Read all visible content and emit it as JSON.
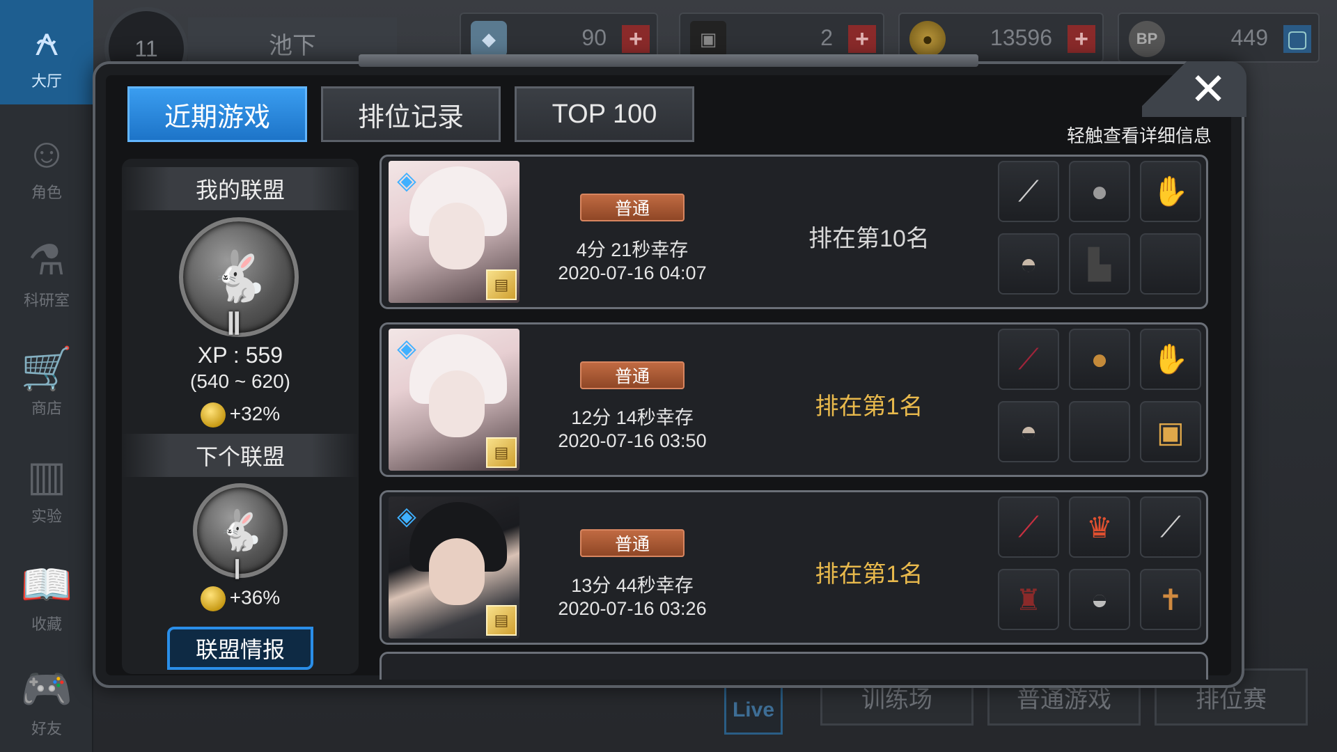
{
  "sidebar": {
    "items": [
      {
        "label": "大厅",
        "icon": "lobby-icon",
        "active": true
      },
      {
        "label": "角色",
        "icon": "character-icon"
      },
      {
        "label": "科研室",
        "icon": "flask-icon"
      },
      {
        "label": "商店",
        "icon": "cart-icon"
      },
      {
        "label": "实验",
        "icon": "books-icon"
      },
      {
        "label": "收藏",
        "icon": "book-icon"
      },
      {
        "label": "好友",
        "icon": "gamepad-icon"
      }
    ]
  },
  "topbar": {
    "level": "11",
    "player_name": "池下",
    "resources": [
      {
        "icon": "crystal-icon",
        "value": "90"
      },
      {
        "icon": "card-icon",
        "value": "2"
      },
      {
        "icon": "coin-icon",
        "value": "13596"
      },
      {
        "icon": "bp-icon",
        "value": "449",
        "symbol": "BP"
      }
    ]
  },
  "bottom_modes": [
    "训练场",
    "普通游戏",
    "排位赛"
  ],
  "live_label": "Live",
  "modal": {
    "tabs": [
      {
        "label": "近期游戏",
        "active": true
      },
      {
        "label": "排位记录",
        "active": false
      },
      {
        "label": "TOP 100",
        "active": false
      }
    ],
    "hint": "轻触查看详细信息",
    "close_symbol": "✕"
  },
  "league": {
    "my_title": "我的联盟",
    "my_tier": "Ⅱ",
    "xp": "XP : 559",
    "xp_range": "(540 ~ 620)",
    "my_bonus": "+32%",
    "next_title": "下个联盟",
    "next_tier": "Ⅰ",
    "next_bonus": "+36%",
    "info_button": "联盟情报"
  },
  "matches": [
    {
      "portrait": "white",
      "mode": "普通",
      "survive": "4分 21秒幸存",
      "datetime": "2020-07-16 04:07",
      "rank": "排在第10名",
      "top": false,
      "items": [
        "sword-icon",
        "helmet-icon",
        "glove-icon",
        "hat-icon",
        "boots-icon",
        ""
      ]
    },
    {
      "portrait": "white",
      "mode": "普通",
      "survive": "12分 14秒幸存",
      "datetime": "2020-07-16 03:50",
      "rank": "排在第1名",
      "top": true,
      "items": [
        "blade-icon",
        "helmet-icon",
        "glove-icon",
        "hat-icon",
        "",
        "box-icon"
      ]
    },
    {
      "portrait": "black",
      "mode": "普通",
      "survive": "13分 44秒幸存",
      "datetime": "2020-07-16 03:26",
      "rank": "排在第1名",
      "top": true,
      "items": [
        "blade-icon",
        "crown-icon",
        "knife-icon",
        "armor-icon",
        "shoes-icon",
        "cross-icon"
      ]
    }
  ],
  "colors": {
    "tab_active": "#2b8fe6",
    "rank_top": "#e8b94c",
    "mode_tag": "#a85834"
  }
}
